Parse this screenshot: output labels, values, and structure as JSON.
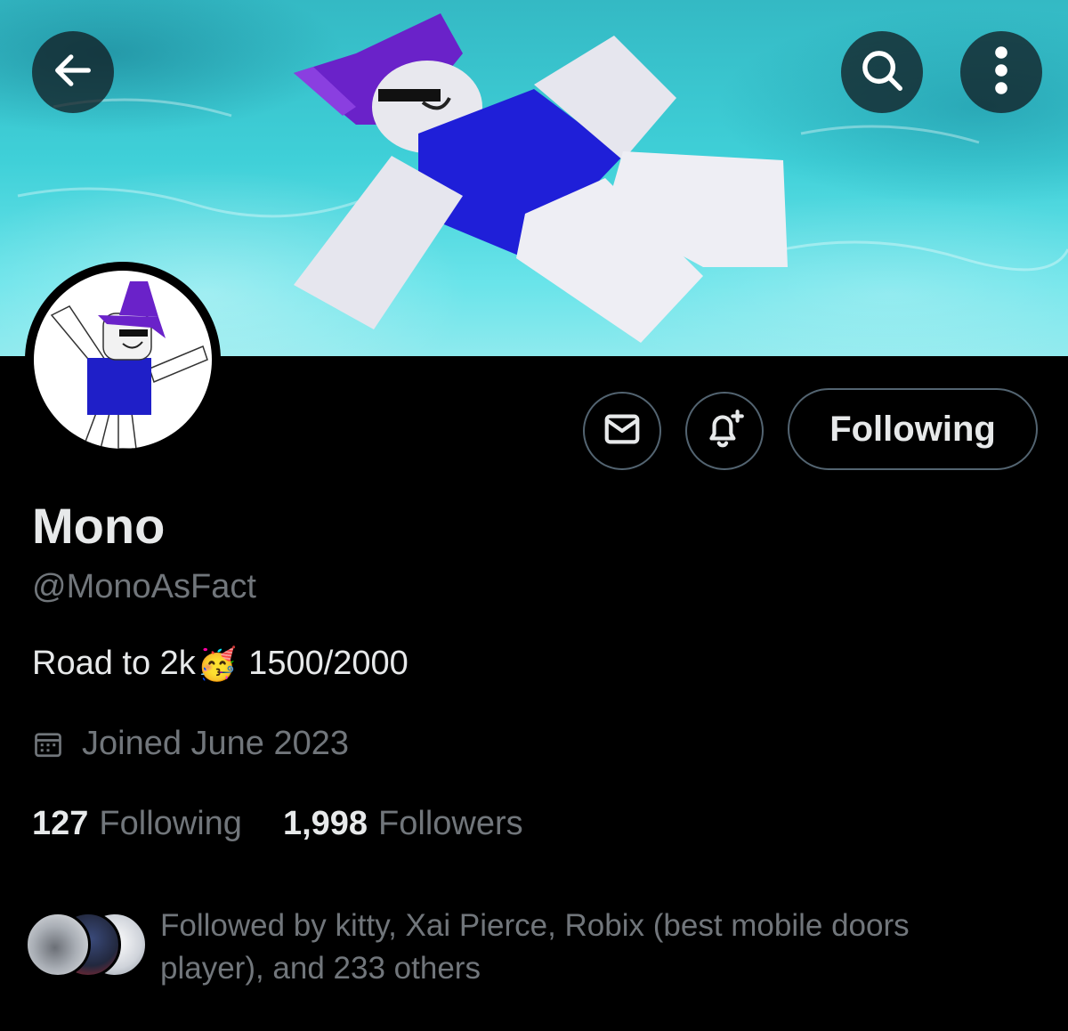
{
  "header": {
    "back_icon": "arrow-left-icon",
    "search_icon": "search-icon",
    "more_icon": "more-vertical-icon"
  },
  "actions": {
    "message_icon": "mail-icon",
    "notify_icon": "bell-plus-icon",
    "following_label": "Following"
  },
  "profile": {
    "name": "Mono",
    "handle": "@MonoAsFact",
    "bio_prefix": "Road to 2k",
    "bio_emoji": "🥳",
    "bio_suffix": " 1500/2000",
    "joined": "Joined June 2023",
    "calendar_icon": "calendar-icon"
  },
  "stats": {
    "following_count": "127",
    "following_label": "Following",
    "followers_count": "1,998",
    "followers_label": "Followers"
  },
  "followed_by": {
    "text": "Followed by kitty, Xai Pierce, Robix (best mobile doors player), and 233 others"
  },
  "colors": {
    "background": "#000000",
    "text_primary": "#e7e9ea",
    "text_secondary": "#71767b",
    "border": "#536471",
    "banner_water": "#3fd0d8",
    "character_blue": "#1f1fd8",
    "hat_purple": "#6a22c9"
  }
}
